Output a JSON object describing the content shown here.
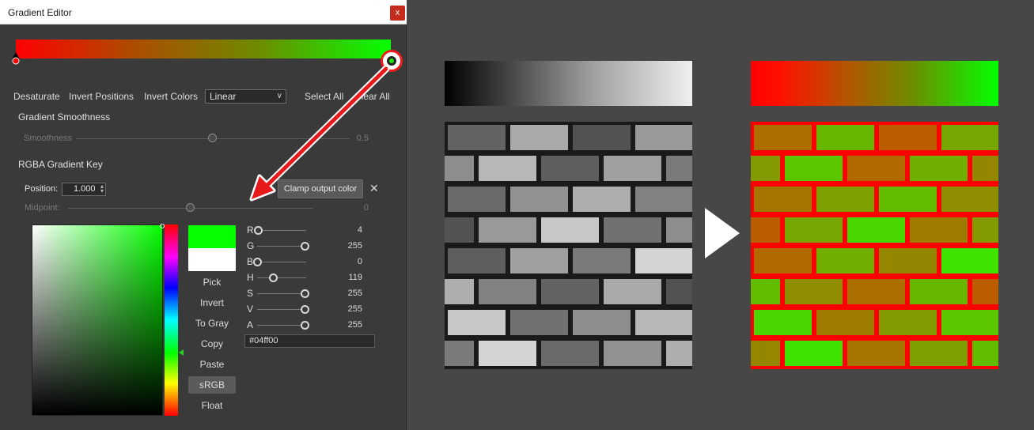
{
  "window": {
    "title": "Gradient Editor",
    "close_glyph": "x"
  },
  "toolbar": {
    "desaturate": "Desaturate",
    "invert_positions": "Invert Positions",
    "invert_colors": "Invert Colors",
    "interpolation": "Linear",
    "select_all": "Select All",
    "clear_all": "Clear All"
  },
  "smoothness": {
    "section": "Gradient Smoothness",
    "label": "Smoothness",
    "value": "0.5",
    "fraction": 0.5
  },
  "key": {
    "section": "RGBA Gradient Key",
    "position_label": "Position:",
    "position_value": "1.000",
    "tooltip": "Clamp output color",
    "remove_glyph": "✕",
    "midpoint_label": "Midpoint:",
    "midpoint_value": "0",
    "midpoint_fraction": 0.5
  },
  "color": {
    "new_swatch": "#04ff00",
    "old_swatch": "#ffffff",
    "hue_fraction": 0.33,
    "hex": "#04ff00",
    "buttons": [
      "Pick",
      "Invert",
      "To Gray",
      "Copy",
      "Paste",
      "sRGB",
      "Float"
    ],
    "active_button": "sRGB",
    "channels": [
      {
        "label": "R",
        "value": "4",
        "fraction": 0.02
      },
      {
        "label": "G",
        "value": "255",
        "fraction": 1.0
      },
      {
        "label": "B",
        "value": "0",
        "fraction": 0.0
      },
      {
        "label": "H",
        "value": "119",
        "fraction": 0.33
      },
      {
        "label": "S",
        "value": "255",
        "fraction": 1.0
      },
      {
        "label": "V",
        "value": "255",
        "fraction": 1.0
      },
      {
        "label": "A",
        "value": "255",
        "fraction": 1.0
      }
    ]
  },
  "gradient": {
    "colors": [
      "#ff0000",
      "#04ff00"
    ],
    "annotation_color": "#e8191b"
  },
  "preview": {
    "mortar_before": "#1a1a1a",
    "mortar_after": "#ff0000"
  }
}
